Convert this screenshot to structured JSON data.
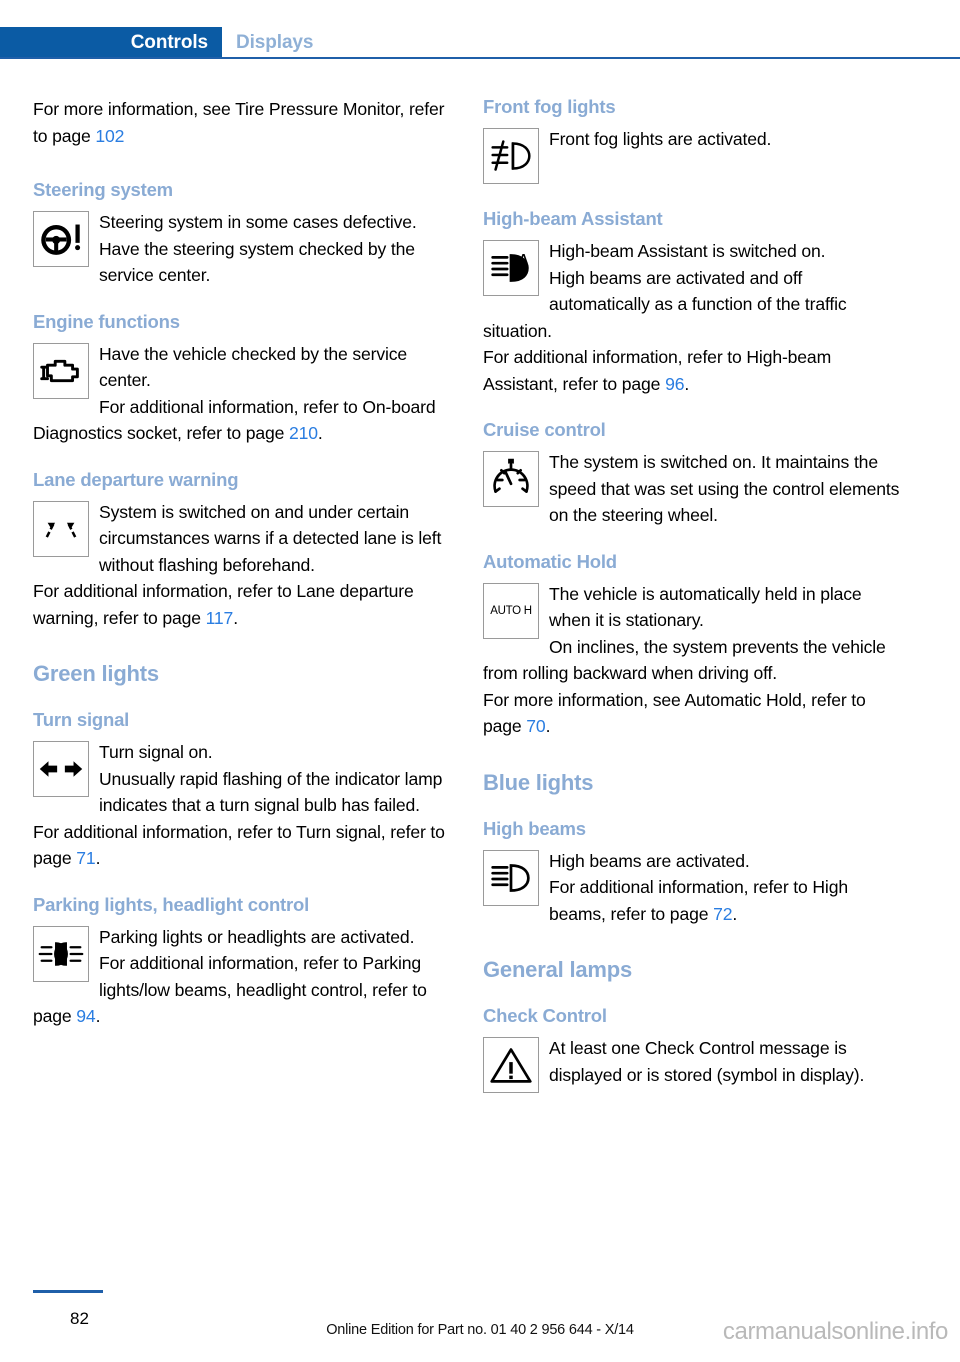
{
  "header": {
    "tab_active": "Controls",
    "tab_inactive": "Displays",
    "active_bg": "#0b5ba4",
    "active_fg": "#ffffff",
    "inactive_fg": "#8fb0d6",
    "rule_color": "#1f5fa9"
  },
  "theme": {
    "heading_color": "#8aabd4",
    "link_color": "#2a7de1",
    "body_color": "#000000"
  },
  "left_column": {
    "intro": {
      "text_before": "For more information, see Tire Pressure Monitor, refer to page ",
      "page_ref": "102",
      "text_after": ""
    },
    "steering": {
      "heading": "Steering system",
      "icon": "steering-wheel-warning-icon",
      "body1": "Steering system in some cases defective.",
      "body2": "Have the steering system checked by the service center."
    },
    "engine": {
      "heading": "Engine functions",
      "icon": "engine-check-icon",
      "body1": "Have the vehicle checked by the service center.",
      "body2_before": "For additional information, refer to On-board Diagnostics socket, refer to page ",
      "page_ref": "210",
      "body2_after": "."
    },
    "lane": {
      "heading": "Lane departure warning",
      "icon": "lane-departure-warning-icon",
      "body1": "System is switched on and under certain circumstances warns if a detected lane is left without flashing beforehand.",
      "body2_before": "For additional information, refer to Lane departure warning, refer to page ",
      "page_ref": "117",
      "body2_after": "."
    },
    "green_lights": {
      "heading": "Green lights"
    },
    "turn_signal": {
      "heading": "Turn signal",
      "icon": "turn-signal-arrows-icon",
      "body1": "Turn signal on.",
      "body2": "Unusually rapid flashing of the indicator lamp indicates that a turn signal bulb has failed.",
      "body3_before": "For additional information, refer to Turn signal, refer to page ",
      "page_ref": "71",
      "body3_after": "."
    },
    "parking_lights": {
      "heading": "Parking lights, headlight control",
      "icon": "parking-lights-icon",
      "body1": "Parking lights or headlights are activated.",
      "body2_before": "For additional information, refer to Parking lights/low beams, headlight control, refer to page ",
      "page_ref": "94",
      "body2_after": "."
    }
  },
  "right_column": {
    "front_fog": {
      "heading": "Front fog lights",
      "icon": "front-fog-light-icon",
      "body1": "Front fog lights are activated."
    },
    "high_beam_assistant": {
      "heading": "High-beam Assistant",
      "icon": "high-beam-assistant-icon",
      "body1": "High-beam Assistant is switched on.",
      "body2": "High beams are activated and off automatically as a function of the traffic situation.",
      "body3_before": "For additional information, refer to High-beam Assistant, refer to page ",
      "page_ref": "96",
      "body3_after": "."
    },
    "cruise_control": {
      "heading": "Cruise control",
      "icon": "cruise-control-gauge-icon",
      "body1": "The system is switched on. It maintains the speed that was set using the control elements on the steering wheel."
    },
    "automatic_hold": {
      "heading": "Automatic Hold",
      "icon": "auto-hold-icon",
      "icon_text": "AUTO H",
      "body1": "The vehicle is automatically held in place when it is stationary.",
      "body2": "On inclines, the system prevents the vehicle from rolling backward when driving off.",
      "body3_before": "For more information, see Automatic Hold, refer to page ",
      "page_ref": "70",
      "body3_after": "."
    },
    "blue_lights": {
      "heading": "Blue lights"
    },
    "high_beams": {
      "heading": "High beams",
      "icon": "high-beam-icon",
      "body1": "High beams are activated.",
      "body2_before": "For additional information, refer to High beams, refer to page ",
      "page_ref": "72",
      "body2_after": "."
    },
    "general_lamps": {
      "heading": "General lamps"
    },
    "check_control": {
      "heading": "Check Control",
      "icon": "warning-triangle-icon",
      "body1": "At least one Check Control message is displayed or is stored (symbol in display)."
    }
  },
  "footer": {
    "page_number": "82",
    "edition_note": "Online Edition for Part no. 01 40 2 956 644 - X/14",
    "watermark": "carmanualsonline.info"
  }
}
